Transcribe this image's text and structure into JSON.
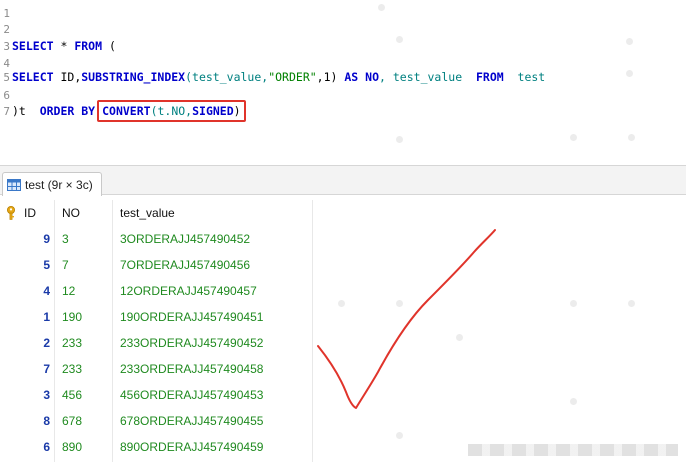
{
  "editor": {
    "lines": [
      {
        "n": "1",
        "parts": []
      },
      {
        "n": "2",
        "parts": []
      },
      {
        "n": "3",
        "parts": [
          {
            "t": "SELECT",
            "c": "kw"
          },
          {
            "t": " * ",
            "c": "plain"
          },
          {
            "t": "FROM",
            "c": "kw"
          },
          {
            "t": " (",
            "c": "plain"
          }
        ]
      },
      {
        "n": "4",
        "parts": []
      },
      {
        "n": "5",
        "parts": [
          {
            "t": "SELECT",
            "c": "kw"
          },
          {
            "t": " ID,",
            "c": "plain"
          },
          {
            "t": "SUBSTRING_INDEX",
            "c": "fn"
          },
          {
            "t": "(test_value,",
            "c": "id"
          },
          {
            "t": "\"ORDER\"",
            "c": "str"
          },
          {
            "t": ",1) ",
            "c": "plain"
          },
          {
            "t": "AS",
            "c": "kw"
          },
          {
            "t": " ",
            "c": "plain"
          },
          {
            "t": "NO",
            "c": "kw"
          },
          {
            "t": ", test_value  ",
            "c": "id"
          },
          {
            "t": "FROM",
            "c": "kw"
          },
          {
            "t": "  test",
            "c": "id"
          }
        ]
      },
      {
        "n": "6",
        "parts": []
      },
      {
        "n": "7",
        "parts": [
          {
            "t": ")t  ",
            "c": "plain"
          },
          {
            "t": "ORDER BY",
            "c": "kw"
          }
        ],
        "boxed": [
          {
            "t": "CONVERT",
            "c": "fn"
          },
          {
            "t": "(t.NO,",
            "c": "id"
          },
          {
            "t": "SIGNED",
            "c": "kw"
          },
          {
            "t": ")",
            "c": "plain"
          }
        ]
      }
    ]
  },
  "result_tab": {
    "label": "test (9r × 3c)"
  },
  "table": {
    "columns": [
      "ID",
      "NO",
      "test_value"
    ],
    "rows": [
      [
        "9",
        "3",
        "3ORDERAJJ457490452"
      ],
      [
        "5",
        "7",
        "7ORDERAJJ457490456"
      ],
      [
        "4",
        "12",
        "12ORDERAJJ457490457"
      ],
      [
        "1",
        "190",
        "190ORDERAJJ457490451"
      ],
      [
        "2",
        "233",
        "233ORDERAJJ457490452"
      ],
      [
        "7",
        "233",
        "233ORDERAJJ457490458"
      ],
      [
        "3",
        "456",
        "456ORDERAJJ457490453"
      ],
      [
        "8",
        "678",
        "678ORDERAJJ457490455"
      ],
      [
        "6",
        "890",
        "890ORDERAJJ457490459"
      ]
    ]
  },
  "colors": {
    "highlight_border": "#e0342b",
    "checkmark": "#e0342b",
    "keyword": "#0000cc",
    "identifier": "#008080",
    "string": "#008000",
    "cell_green": "#1f8a1f",
    "id_blue": "#1a3aa8",
    "key_icon": "#e6a817"
  },
  "icons": {
    "tab": "table-grid-icon",
    "primary_key": "key-icon",
    "annotation": "checkmark-icon"
  }
}
